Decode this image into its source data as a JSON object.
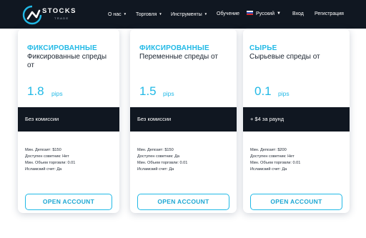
{
  "brand": {
    "name": "STOCKS",
    "subtitle": "TRADE"
  },
  "nav": {
    "items": [
      {
        "label": "О нас",
        "has_dropdown": true
      },
      {
        "label": "Торговля",
        "has_dropdown": true
      },
      {
        "label": "Инструменты",
        "has_dropdown": true
      },
      {
        "label": "Обучение",
        "has_dropdown": false
      }
    ],
    "language": "Русский",
    "login": "Вход",
    "register": "Регистрация"
  },
  "cards": [
    {
      "title": "ФИКСИРОВАННЫЕ",
      "subtitle": "Фиксированные спреды от",
      "spread_value": "1.8",
      "spread_unit": "pips",
      "band_text": "Без комиссии",
      "details": [
        "Мин. Депозит: $150",
        "Доступен советник: Нет",
        "Мин. Объем торговли: 0.01",
        "Исламский счет: Да"
      ],
      "button": "OPEN ACCOUNT"
    },
    {
      "title": "ФИКСИРОВАННЫЕ",
      "subtitle": "Переменные спреды от",
      "spread_value": "1.5",
      "spread_unit": "pips",
      "band_text": "Без комиссии",
      "details": [
        "Мин. Депозит: $150",
        "Доступен советник: Да",
        "Мин. Объем торговли: 0.01",
        "Исламский счет: Да"
      ],
      "button": "OPEN ACCOUNT"
    },
    {
      "title": "СЫРЬЕ",
      "subtitle": "Сырьевые спреды от",
      "spread_value": "0.1",
      "spread_unit": "pips",
      "band_text": "+ $4 за раунд",
      "details": [
        "Мин. Депозит: $200",
        "Доступен советник: Нет",
        "Мин. Объем торговли: 0.01",
        "Исламский счет: Да"
      ],
      "button": "OPEN ACCOUNT"
    }
  ],
  "colors": {
    "accent": "#21b9e6",
    "dark": "#101721",
    "text": "#1b2430"
  }
}
